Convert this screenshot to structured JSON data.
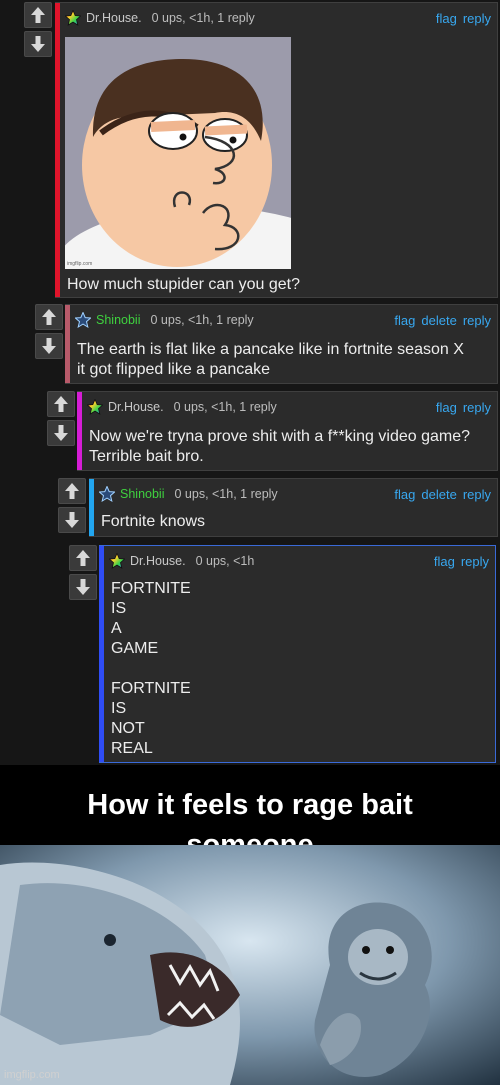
{
  "comments": [
    {
      "user": "Dr.House.",
      "meta": "0 ups, <1h, 1 reply",
      "actions": [
        "flag",
        "reply"
      ],
      "text": "How much stupider can you get?",
      "bar_color": "#e0142b",
      "user_color": "#c9c9c9",
      "star_icon": "rainbow-star-icon"
    },
    {
      "user": "Shinobii",
      "meta": "0 ups, <1h, 1 reply",
      "actions": [
        "flag",
        "delete",
        "reply"
      ],
      "text": "The earth is flat like a pancake like in fortnite season X\nit got flipped like a pancake",
      "bar_color": "#b85a6a",
      "user_color": "#3fd13f",
      "star_icon": "blue-star-icon"
    },
    {
      "user": "Dr.House.",
      "meta": "0 ups, <1h, 1 reply",
      "actions": [
        "flag",
        "reply"
      ],
      "text": "Now we're tryna prove shit with a f**king video game?\nTerrible bait bro.",
      "bar_color": "#d61dd6",
      "user_color": "#c9c9c9",
      "star_icon": "rainbow-star-icon"
    },
    {
      "user": "Shinobii",
      "meta": "0 ups, <1h, 1 reply",
      "actions": [
        "flag",
        "delete",
        "reply"
      ],
      "text": "Fortnite knows",
      "bar_color": "#22a6f0",
      "user_color": "#3fd13f",
      "star_icon": "blue-star-icon"
    },
    {
      "user": "Dr.House.",
      "meta": "0 ups, <1h",
      "actions": [
        "flag",
        "reply"
      ],
      "text": "FORTNITE\nIS\nA\nGAME\n\nFORTNITE\nIS\nNOT\nREAL",
      "bar_color": "#2f4df5",
      "user_color": "#c9c9c9",
      "star_icon": "rainbow-star-icon"
    }
  ],
  "meme_top_watermark": "imgflip.com",
  "meme_bottom": {
    "caption_line1": "How it feels to rage bait",
    "caption_line2": "someone",
    "watermark": "imgflip.com"
  }
}
